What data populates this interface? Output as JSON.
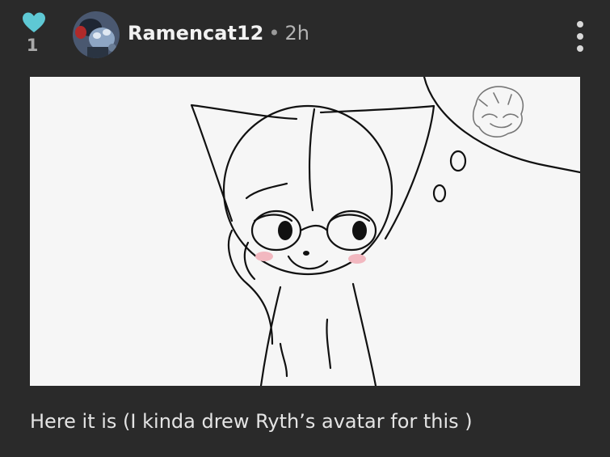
{
  "post": {
    "like_count": "1",
    "username": "Ramencat12",
    "separator": "•",
    "time_ago": "2h",
    "caption": "Here it is (I kinda drew Ryth’s avatar for this )"
  },
  "icons": {
    "like": "heart-icon",
    "menu": "more-vertical-icon"
  },
  "colors": {
    "background": "#2a2a2a",
    "heart": "#5ec8d4",
    "like_count": "#aaaaaa",
    "username": "#f2f2f2"
  }
}
